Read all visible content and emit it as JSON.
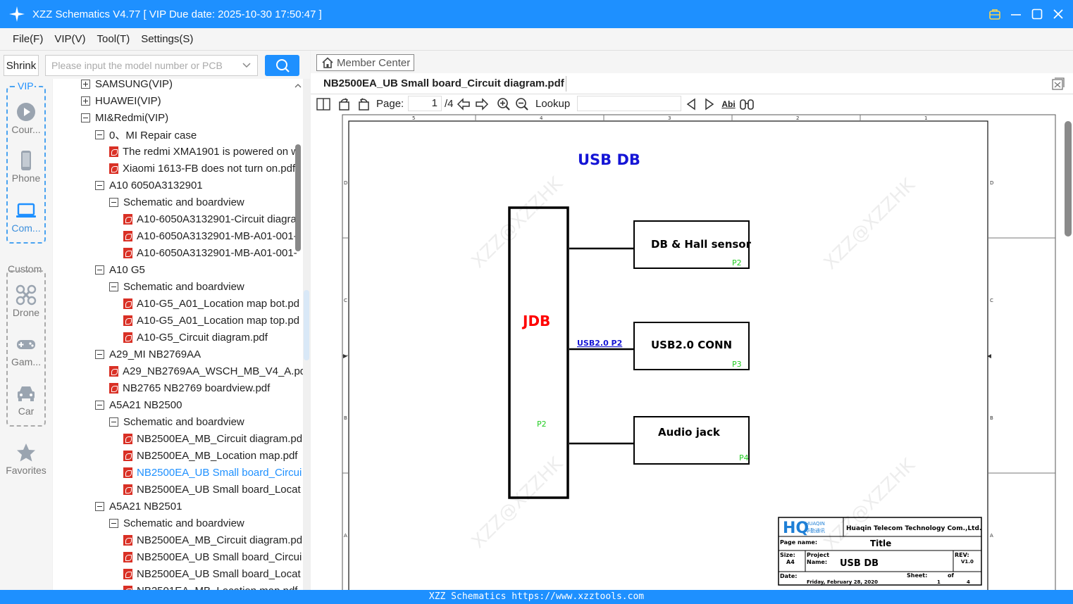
{
  "app": {
    "title": "XZZ Schematics V4.77 [ VIP Due date: 2025-10-30 17:50:47 ]",
    "footer": "XZZ Schematics https://www.xzztools.com",
    "accent_color": "#1e90ff"
  },
  "menu": [
    "File(F)",
    "VIP(V)",
    "Tool(T)",
    "Settings(S)"
  ],
  "search": {
    "shrink_label": "Shrink",
    "placeholder": "Please input the model number or PCB"
  },
  "categories": {
    "vip_label": "VIP",
    "vip_items": [
      {
        "label": "Cour...",
        "icon": "play-icon"
      },
      {
        "label": "Phone",
        "icon": "phone-icon"
      },
      {
        "label": "Com...",
        "icon": "laptop-icon"
      }
    ],
    "custom_label": "Custom",
    "custom_items": [
      {
        "label": "Drone",
        "icon": "drone-icon"
      },
      {
        "label": "Gam...",
        "icon": "gamepad-icon"
      },
      {
        "label": "Car",
        "icon": "car-icon"
      }
    ],
    "favorites_label": "Favorites"
  },
  "tree": [
    {
      "label": "SAMSUNG(VIP)",
      "type": "folder",
      "state": "collapsed",
      "depth": 0
    },
    {
      "label": "HUAWEI(VIP)",
      "type": "folder",
      "state": "collapsed",
      "depth": 0
    },
    {
      "label": "MI&Redmi(VIP)",
      "type": "folder",
      "state": "expanded",
      "depth": 0
    },
    {
      "label": "0、MI Repair case",
      "type": "folder",
      "state": "expanded",
      "depth": 1
    },
    {
      "label": "The redmi XMA1901 is powered on w",
      "type": "pdf",
      "depth": 2
    },
    {
      "label": "Xiaomi 1613-FB does not turn on.pdf",
      "type": "pdf",
      "depth": 2
    },
    {
      "label": "A10 6050A3132901",
      "type": "folder",
      "state": "expanded",
      "depth": 1
    },
    {
      "label": "Schematic and boardview",
      "type": "folder",
      "state": "expanded",
      "depth": 2
    },
    {
      "label": "A10-6050A3132901-Circuit diagra",
      "type": "pdf",
      "depth": 3
    },
    {
      "label": "A10-6050A3132901-MB-A01-001-",
      "type": "pdf",
      "depth": 3
    },
    {
      "label": "A10-6050A3132901-MB-A01-001-",
      "type": "pdf",
      "depth": 3
    },
    {
      "label": "A10 G5",
      "type": "folder",
      "state": "expanded",
      "depth": 1
    },
    {
      "label": "Schematic and boardview",
      "type": "folder",
      "state": "expanded",
      "depth": 2
    },
    {
      "label": "A10-G5_A01_Location map bot.pd",
      "type": "pdf",
      "depth": 3
    },
    {
      "label": "A10-G5_A01_Location map top.pd",
      "type": "pdf",
      "depth": 3
    },
    {
      "label": "A10-G5_Circuit diagram.pdf",
      "type": "pdf",
      "depth": 3
    },
    {
      "label": "A29_MI NB2769AA",
      "type": "folder",
      "state": "expanded",
      "depth": 1
    },
    {
      "label": "A29_NB2769AA_WSCH_MB_V4_A.pdf",
      "type": "pdf",
      "depth": 2
    },
    {
      "label": "NB2765  NB2769 boardview.pdf",
      "type": "pdf",
      "depth": 2
    },
    {
      "label": "A5A21 NB2500",
      "type": "folder",
      "state": "expanded",
      "depth": 1
    },
    {
      "label": "Schematic and boardview",
      "type": "folder",
      "state": "expanded",
      "depth": 2
    },
    {
      "label": "NB2500EA_MB_Circuit diagram.pd",
      "type": "pdf",
      "depth": 3
    },
    {
      "label": "NB2500EA_MB_Location map.pdf",
      "type": "pdf",
      "depth": 3
    },
    {
      "label": "NB2500EA_UB Small board_Circui",
      "type": "pdf",
      "depth": 3,
      "selected": true
    },
    {
      "label": "NB2500EA_UB Small board_Locat",
      "type": "pdf",
      "depth": 3
    },
    {
      "label": "A5A21 NB2501",
      "type": "folder",
      "state": "expanded",
      "depth": 1
    },
    {
      "label": "Schematic and boardview",
      "type": "folder",
      "state": "expanded",
      "depth": 2
    },
    {
      "label": "NB2500EA_MB_Circuit diagram.pd",
      "type": "pdf",
      "depth": 3
    },
    {
      "label": "NB2500EA_UB Small board_Circui",
      "type": "pdf",
      "depth": 3
    },
    {
      "label": "NB2500EA_UB Small board_Locat",
      "type": "pdf",
      "depth": 3
    },
    {
      "label": "NB2501EA_MB_Location map.pdf",
      "type": "pdf",
      "depth": 3
    }
  ],
  "viewer": {
    "member_center": "Member Center",
    "doc_title": "NB2500EA_UB Small board_Circuit diagram.pdf",
    "page_label": "Page:",
    "page_current": "1",
    "page_total": "/4",
    "lookup_label": "Lookup",
    "find_case_label": "Abi"
  },
  "schematic": {
    "heading": "USB DB",
    "main_block": "JDB",
    "main_block_page": "P2",
    "blocks": [
      {
        "label": "DB & Hall sensor",
        "page": "P2"
      },
      {
        "label": "USB2.0 CONN",
        "page": "P3"
      },
      {
        "label": "Audio jack",
        "page": "P4"
      }
    ],
    "net_label": "USB2.0 P2",
    "watermark": "XZZ@XZZHK",
    "col_labels": [
      "5",
      "4",
      "3",
      "2",
      "1"
    ],
    "row_labels": [
      "D",
      "C",
      "B",
      "A"
    ],
    "title_block": {
      "logo_text": "HUAQIN",
      "logo_sub": "华勤通讯",
      "company": "Huaqin Telecom Technology Com.,Ltd.",
      "page_name_label": "Page name:",
      "page_name_value": "Title",
      "size_label": "Size:",
      "size_value": "A4",
      "project_label": "Project",
      "project_name_label": "Name:",
      "project_value": "USB DB",
      "rev_label": "REV:",
      "rev_value": "V1.0",
      "date_label": "Date:",
      "date_value": "Friday, February 28, 2020",
      "sheet_label": "Sheet:",
      "sheet_value": "1",
      "of_label": "of",
      "of_value": "4"
    },
    "colors": {
      "heading": "#1515d6",
      "jdb": "#ff0000",
      "page_tag": "#22cc22",
      "net_label": "#1515d6"
    }
  }
}
